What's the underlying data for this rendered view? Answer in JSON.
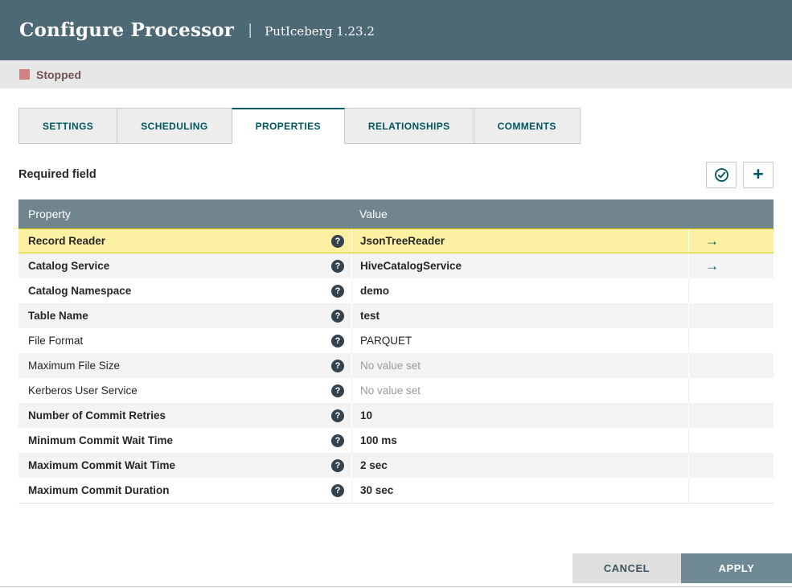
{
  "header": {
    "title": "Configure Processor",
    "separator": "|",
    "subtitle": "PutIceberg 1.23.2"
  },
  "status": {
    "label": "Stopped"
  },
  "tabs": [
    {
      "label": "SETTINGS",
      "active": false
    },
    {
      "label": "SCHEDULING",
      "active": false
    },
    {
      "label": "PROPERTIES",
      "active": true
    },
    {
      "label": "RELATIONSHIPS",
      "active": false
    },
    {
      "label": "COMMENTS",
      "active": false
    }
  ],
  "toolbar": {
    "required_field_label": "Required field",
    "verify_button_icon": "check-circle",
    "add_button_icon": "plus"
  },
  "icons": {
    "help_glyph": "?",
    "goto_glyph": "→",
    "plus_glyph": "+"
  },
  "table": {
    "headers": [
      "Property",
      "Value"
    ],
    "rows": [
      {
        "property": "Record Reader",
        "value": "JsonTreeReader",
        "required": true,
        "selected": true,
        "has_link": true,
        "value_set": true
      },
      {
        "property": "Catalog Service",
        "value": "HiveCatalogService",
        "required": true,
        "selected": false,
        "has_link": true,
        "value_set": true
      },
      {
        "property": "Catalog Namespace",
        "value": "demo",
        "required": true,
        "selected": false,
        "has_link": false,
        "value_set": true
      },
      {
        "property": "Table Name",
        "value": "test",
        "required": true,
        "selected": false,
        "has_link": false,
        "value_set": true
      },
      {
        "property": "File Format",
        "value": "PARQUET",
        "required": false,
        "selected": false,
        "has_link": false,
        "value_set": true
      },
      {
        "property": "Maximum File Size",
        "value": "No value set",
        "required": false,
        "selected": false,
        "has_link": false,
        "value_set": false
      },
      {
        "property": "Kerberos User Service",
        "value": "No value set",
        "required": false,
        "selected": false,
        "has_link": false,
        "value_set": false
      },
      {
        "property": "Number of Commit Retries",
        "value": "10",
        "required": true,
        "selected": false,
        "has_link": false,
        "value_set": true
      },
      {
        "property": "Minimum Commit Wait Time",
        "value": "100 ms",
        "required": true,
        "selected": false,
        "has_link": false,
        "value_set": true
      },
      {
        "property": "Maximum Commit Wait Time",
        "value": "2 sec",
        "required": true,
        "selected": false,
        "has_link": false,
        "value_set": true
      },
      {
        "property": "Maximum Commit Duration",
        "value": "30 sec",
        "required": true,
        "selected": false,
        "has_link": false,
        "value_set": true
      }
    ]
  },
  "footer": {
    "cancel_label": "CANCEL",
    "apply_label": "APPLY"
  },
  "colors": {
    "header_bg": "#4d6976",
    "accent_teal": "#00565f",
    "table_header_bg": "#71858f",
    "selected_row_bg": "#fcf0a2",
    "selected_row_border": "#ddc900",
    "stopped_red": "#cf8383",
    "apply_bg": "#6f8a95",
    "status_bar_bg": "#e7e7e7"
  }
}
